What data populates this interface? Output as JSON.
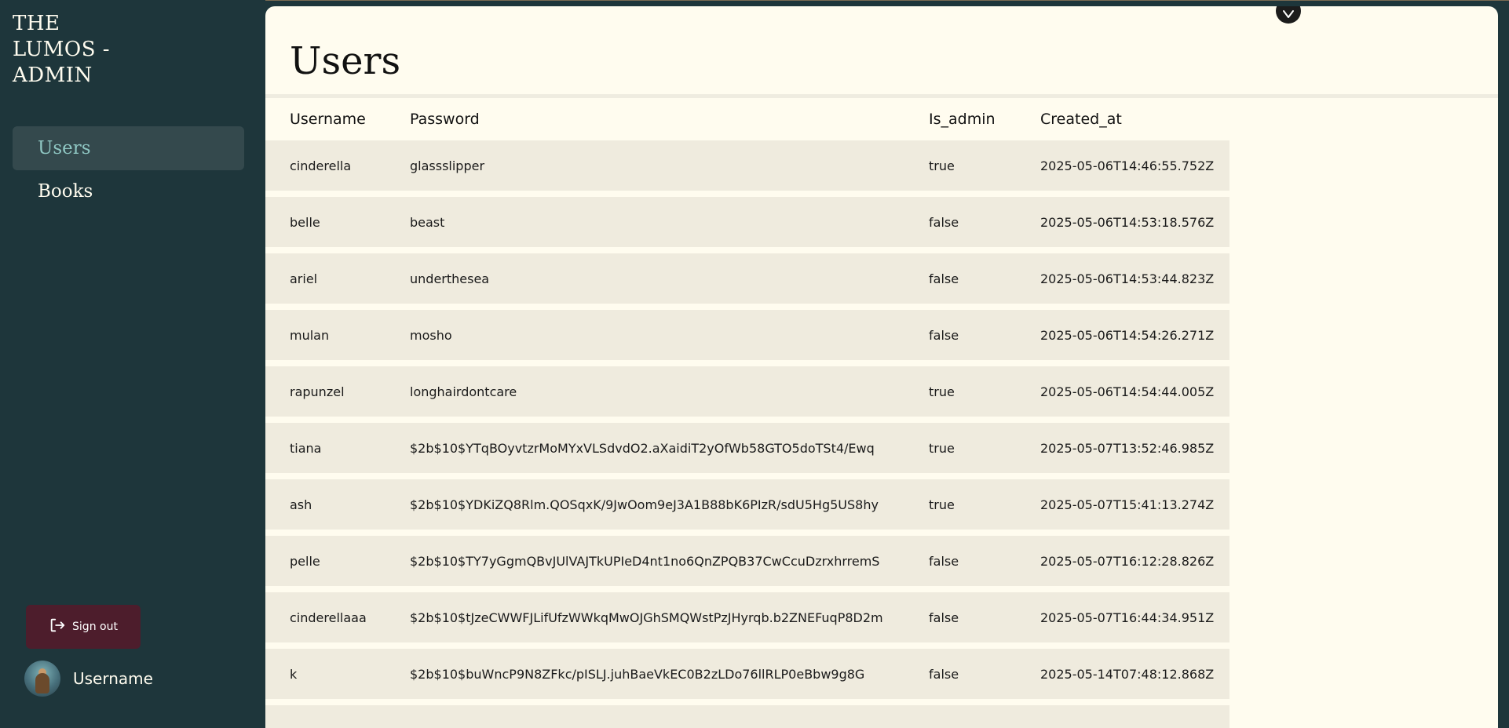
{
  "brand": {
    "lines": [
      "THE",
      "LUMOS -",
      "ADMIN"
    ]
  },
  "sidebar": {
    "items": [
      {
        "label": "Users",
        "active": true
      },
      {
        "label": "Books",
        "active": false
      }
    ],
    "signout_label": "Sign out",
    "profile_name": "Username"
  },
  "page": {
    "title": "Users"
  },
  "table": {
    "headers": [
      "Username",
      "Password",
      "Is_admin",
      "Created_at"
    ],
    "rows": [
      [
        "cinderella",
        "glassslipper",
        "true",
        "2025-05-06T14:46:55.752Z"
      ],
      [
        "belle",
        "beast",
        "false",
        "2025-05-06T14:53:18.576Z"
      ],
      [
        "ariel",
        "underthesea",
        "false",
        "2025-05-06T14:53:44.823Z"
      ],
      [
        "mulan",
        "mosho",
        "false",
        "2025-05-06T14:54:26.271Z"
      ],
      [
        "rapunzel",
        "longhairdontcare",
        "true",
        "2025-05-06T14:54:44.005Z"
      ],
      [
        "tiana",
        "$2b$10$YTqBOyvtzrMoMYxVLSdvdO2.aXaidiT2yOfWb58GTO5doTSt4/Ewq",
        "true",
        "2025-05-07T13:52:46.985Z"
      ],
      [
        "ash",
        "$2b$10$YDKiZQ8Rlm.QOSqxK/9JwOom9eJ3A1B88bK6PIzR/sdU5Hg5US8hy",
        "true",
        "2025-05-07T15:41:13.274Z"
      ],
      [
        "pelle",
        "$2b$10$TY7yGgmQBvJUlVAJTkUPIeD4nt1no6QnZPQB37CwCcuDzrxhrremS",
        "false",
        "2025-05-07T16:12:28.826Z"
      ],
      [
        "cinderellaaa",
        "$2b$10$tJzeCWWFJLifUfzWWkqMwOJGhSMQWstPzJHyrqb.b2ZNEFuqP8D2m",
        "false",
        "2025-05-07T16:44:34.951Z"
      ],
      [
        "k",
        "$2b$10$buWncP9N8ZFkc/pISLJ.juhBaeVkEC0B2zLDo76llRLP0eBbw9g8G",
        "false",
        "2025-05-14T07:48:12.868Z"
      ],
      [
        "",
        "",
        "",
        ""
      ]
    ]
  },
  "icons": {
    "signout": "logout-icon",
    "collapse": "chevron-down-icon",
    "avatar": "user-avatar"
  },
  "colors": {
    "sidebar_bg": "#1e363b",
    "active_nav_bg": "#34494d",
    "active_nav_text": "#8fc7c3",
    "main_bg": "#fffcef",
    "row_bg": "#efebde",
    "signout_bg": "#4d1d2c"
  }
}
